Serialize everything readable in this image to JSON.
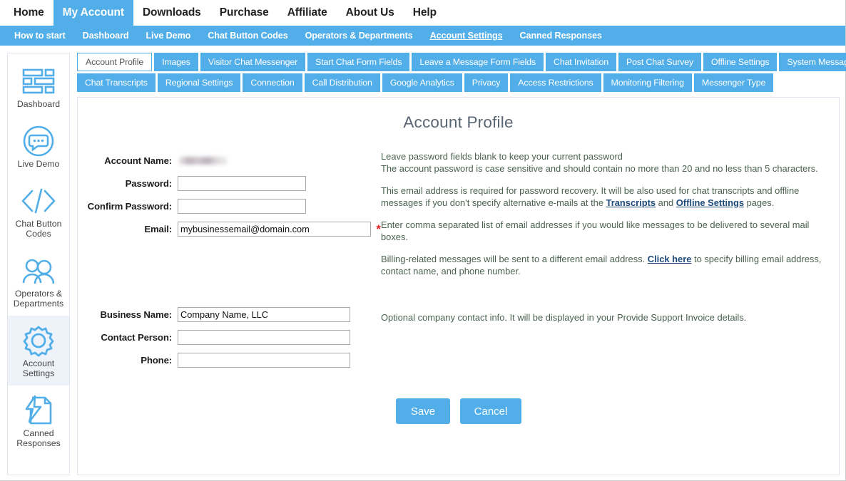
{
  "topnav": {
    "items": [
      {
        "label": "Home",
        "active": false
      },
      {
        "label": "My Account",
        "active": true
      },
      {
        "label": "Downloads",
        "active": false
      },
      {
        "label": "Purchase",
        "active": false
      },
      {
        "label": "Affiliate",
        "active": false
      },
      {
        "label": "About Us",
        "active": false
      },
      {
        "label": "Help",
        "active": false
      }
    ]
  },
  "subnav": {
    "items": [
      {
        "label": "How to start",
        "current": false
      },
      {
        "label": "Dashboard",
        "current": false
      },
      {
        "label": "Live Demo",
        "current": false
      },
      {
        "label": "Chat Button Codes",
        "current": false
      },
      {
        "label": "Operators & Departments",
        "current": false
      },
      {
        "label": "Account Settings",
        "current": true
      },
      {
        "label": "Canned Responses",
        "current": false
      }
    ]
  },
  "sidebar": {
    "items": [
      {
        "label": "Dashboard",
        "icon": "dashboard-icon",
        "active": false
      },
      {
        "label": "Live Demo",
        "icon": "chat-bubble-icon",
        "active": false
      },
      {
        "label": "Chat Button Codes",
        "icon": "code-brackets-icon",
        "active": false
      },
      {
        "label": "Operators & Departments",
        "icon": "people-icon",
        "active": false
      },
      {
        "label": "Account Settings",
        "icon": "gear-icon",
        "active": true
      },
      {
        "label": "Canned Responses",
        "icon": "lightning-document-icon",
        "active": false
      }
    ]
  },
  "tabs": {
    "row1": [
      {
        "label": "Account Profile",
        "active": true
      },
      {
        "label": "Images",
        "active": false
      },
      {
        "label": "Visitor Chat Messenger",
        "active": false
      },
      {
        "label": "Start Chat Form Fields",
        "active": false
      },
      {
        "label": "Leave a Message Form Fields",
        "active": false
      },
      {
        "label": "Chat Invitation",
        "active": false
      },
      {
        "label": "Post Chat Survey",
        "active": false
      },
      {
        "label": "Offline Settings",
        "active": false
      },
      {
        "label": "System Messages",
        "active": false
      }
    ],
    "row2": [
      {
        "label": "Chat Transcripts",
        "active": false
      },
      {
        "label": "Regional Settings",
        "active": false
      },
      {
        "label": "Connection",
        "active": false
      },
      {
        "label": "Call Distribution",
        "active": false
      },
      {
        "label": "Google Analytics",
        "active": false
      },
      {
        "label": "Privacy",
        "active": false
      },
      {
        "label": "Access Restrictions",
        "active": false
      },
      {
        "label": "Monitoring Filtering",
        "active": false
      },
      {
        "label": "Messenger Type",
        "active": false
      }
    ]
  },
  "panel": {
    "title": "Account Profile",
    "fields": {
      "account_name_label": "Account Name:",
      "account_name_value": "",
      "password_label": "Password:",
      "password_value": "",
      "confirm_password_label": "Confirm Password:",
      "confirm_password_value": "",
      "email_label": "Email:",
      "email_value": "mybusinessemail@domain.com",
      "required_marker": "*",
      "business_name_label": "Business Name:",
      "business_name_value": "Company Name, LLC",
      "contact_person_label": "Contact Person:",
      "contact_person_value": "",
      "phone_label": "Phone:",
      "phone_value": ""
    },
    "help": {
      "p1_line1": "Leave password fields blank to keep your current password",
      "p1_line2": "The account password is case sensitive and should contain no more than 20 and no less than 5 characters.",
      "p2_a": "This email address is required for password recovery. It will be also used for chat transcripts and offline messages if you don't specify alternative e-mails at the ",
      "p2_link1": "Transcripts",
      "p2_b": " and ",
      "p2_link2": "Offline Settings",
      "p2_c": " pages.",
      "p3": "Enter comma separated list of email addresses if you would like messages to be delivered to several mail boxes.",
      "p4_a": "Billing-related messages will be sent to a different email address. ",
      "p4_link": "Click here",
      "p4_b": " to specify billing email address, contact name, and phone number.",
      "p5": "Optional company contact info. It will be displayed in your Provide Support Invoice details."
    },
    "buttons": {
      "save": "Save",
      "cancel": "Cancel"
    }
  },
  "colors": {
    "brand_blue": "#51AEE8",
    "required_red": "#e32020",
    "help_green": "#4a6250",
    "link_blue": "#1e4a7a",
    "title_gray": "#5a6673"
  }
}
